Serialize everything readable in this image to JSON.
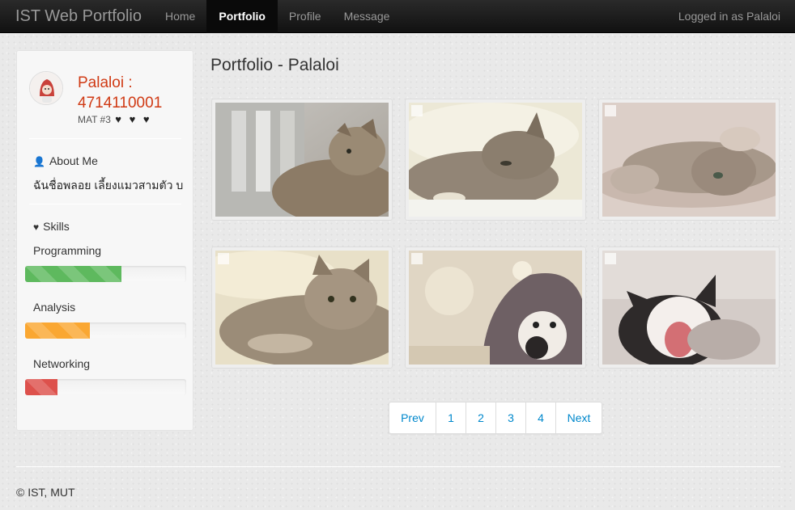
{
  "navbar": {
    "brand": "IST Web Portfolio",
    "items": [
      {
        "label": "Home"
      },
      {
        "label": "Portfolio"
      },
      {
        "label": "Profile"
      },
      {
        "label": "Message"
      }
    ],
    "active_index": 1,
    "user_status": "Logged in as Palaloi"
  },
  "sidebar": {
    "name": "Palaloi :",
    "student_id": "4714110001",
    "mat": "MAT #3",
    "hearts": "♥ ♥ ♥",
    "about_title": "About Me",
    "about_text": "ฉันชื่อพลอย เลี้ยงแมวสามตัว บ",
    "skills_title": "Skills",
    "skills": [
      {
        "label": "Programming",
        "level": 0.6,
        "color": "#5eb95e"
      },
      {
        "label": "Analysis",
        "level": 0.4,
        "color": "#faa732"
      },
      {
        "label": "Networking",
        "level": 0.2,
        "color": "#dd514c"
      }
    ]
  },
  "main": {
    "heading": "Portfolio - Palaloi",
    "thumbnails": [
      {
        "name": "cat-photo-1"
      },
      {
        "name": "cat-photo-2"
      },
      {
        "name": "cat-photo-3"
      },
      {
        "name": "cat-photo-4"
      },
      {
        "name": "cat-photo-5"
      },
      {
        "name": "cat-photo-6"
      }
    ]
  },
  "pagination": {
    "prev": "Prev",
    "pages": [
      "1",
      "2",
      "3",
      "4"
    ],
    "next": "Next"
  },
  "footer": {
    "text": "© IST, MUT"
  },
  "colors": {
    "accent_name": "#d03a14",
    "link": "#0088cc"
  }
}
